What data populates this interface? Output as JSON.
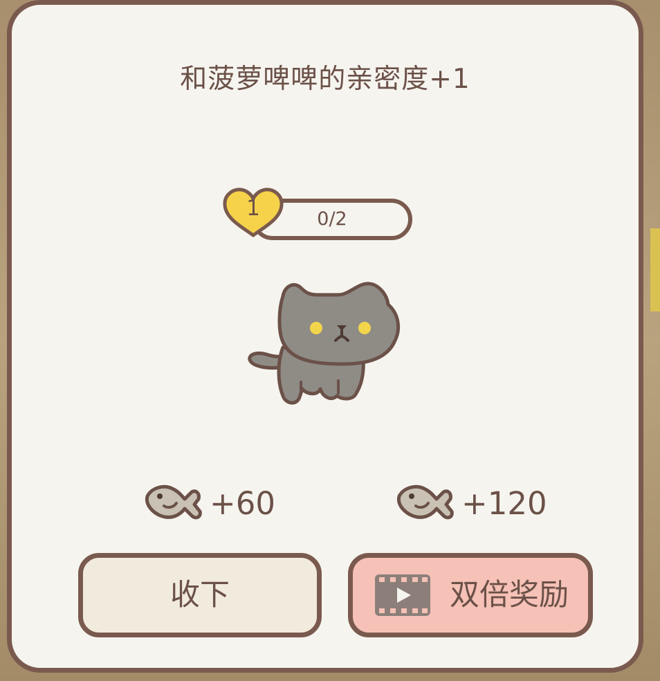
{
  "dialog": {
    "title": "和菠萝啤啤的亲密度+1"
  },
  "affinity": {
    "level": "1",
    "progress_text": "0/2",
    "progress_fraction": 0
  },
  "rewards": {
    "single_amount": "+60",
    "double_amount": "+120",
    "currency_icon": "fish-icon"
  },
  "buttons": {
    "collect_label": "收下",
    "double_label": "双倍奖励",
    "double_icon": "video-play-icon"
  },
  "colors": {
    "panel_bg": "#f6f4ef",
    "border": "#7a5a4e",
    "text": "#6b5148",
    "heart": "#f6d24a",
    "collect_button": "#f1ebdd",
    "double_button": "#f6c1b6",
    "cat_fur": "#8f8c86",
    "cat_eyes": "#f3d54c",
    "fish": "#c9c1b3"
  }
}
